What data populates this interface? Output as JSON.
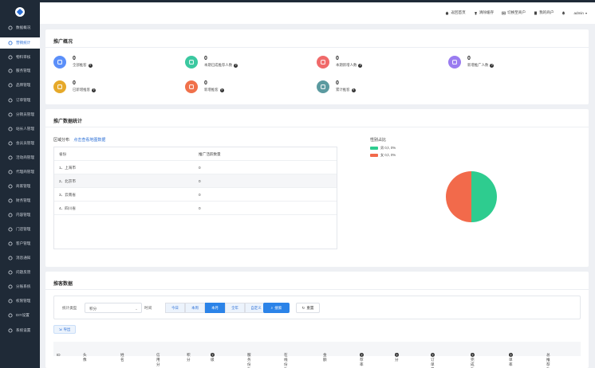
{
  "sidebar": {
    "items": [
      {
        "label": "数据概况",
        "icon": "monitor-icon"
      },
      {
        "label": "营销统计",
        "icon": "chart-icon"
      },
      {
        "label": "物料审核",
        "icon": "box-icon"
      },
      {
        "label": "服务管理",
        "icon": "service-icon"
      },
      {
        "label": "品牌管理",
        "icon": "tag-icon"
      },
      {
        "label": "订单管理",
        "icon": "order-icon"
      },
      {
        "label": "分销员管理",
        "icon": "share-icon"
      },
      {
        "label": "站长人管理",
        "icon": "user-icon"
      },
      {
        "label": "会员员管理",
        "icon": "users-icon"
      },
      {
        "label": "活动商管理",
        "icon": "flag-icon"
      },
      {
        "label": "代理商管理",
        "icon": "agent-icon"
      },
      {
        "label": "商家管理",
        "icon": "shop-icon"
      },
      {
        "label": "财务管理",
        "icon": "wallet-icon"
      },
      {
        "label": "内容管理",
        "icon": "content-icon"
      },
      {
        "label": "门店管理",
        "icon": "store-icon"
      },
      {
        "label": "客户管理",
        "icon": "customer-icon"
      },
      {
        "label": "消息通知",
        "icon": "bell-icon"
      },
      {
        "label": "问题反馈",
        "icon": "feedback-icon"
      },
      {
        "label": "分账系统",
        "icon": "split-icon"
      },
      {
        "label": "权限管理",
        "icon": "lock-icon"
      },
      {
        "label": "DIY设置",
        "icon": "diy-icon"
      },
      {
        "label": "系统设置",
        "icon": "gear-icon"
      }
    ]
  },
  "topbar": {
    "links": [
      {
        "label": "返回首页",
        "icon": "home-icon"
      },
      {
        "label": "清除缓存",
        "icon": "trash-icon"
      },
      {
        "label": "切换至商户",
        "icon": "switch-icon"
      },
      {
        "label": "我的商户",
        "icon": "building-icon"
      }
    ],
    "user": "admin"
  },
  "overview": {
    "title": "推广概况",
    "stats": [
      {
        "value": "0",
        "label": "全部推客",
        "color": "#5b8ff9"
      },
      {
        "value": "0",
        "label": "本期已成推荐人数",
        "color": "#3bc8a0"
      },
      {
        "value": "0",
        "label": "本期新增人数",
        "color": "#f06a6a"
      },
      {
        "value": "0",
        "label": "新增推广人数",
        "color": "#9a7cf0"
      },
      {
        "value": "0",
        "label": "已新增推客",
        "color": "#e6a92a"
      },
      {
        "value": "0",
        "label": "新增推客",
        "color": "#f0714b"
      },
      {
        "value": "0",
        "label": "累计推客",
        "color": "#5b9aa0"
      }
    ]
  },
  "promo_stats": {
    "title": "推广数据统计",
    "region_title": "区域分布",
    "region_link": "点击查看地图数据",
    "table_headers": [
      "省份",
      "推广活跃数量"
    ],
    "rows": [
      {
        "rank": "1、上海市",
        "value": "0"
      },
      {
        "rank": "2、北京市",
        "value": "0"
      },
      {
        "rank": "3、云南省",
        "value": "0"
      },
      {
        "rank": "4、四川省",
        "value": "0"
      }
    ],
    "sex_title": "性别占比",
    "legend": [
      {
        "label": "男 0人 0%",
        "color": "#2ecc8f"
      },
      {
        "label": "女 0人 0%",
        "color": "#f26a4b"
      }
    ],
    "pie": [
      {
        "name": "男",
        "value": 50,
        "color": "#2ecc8f"
      },
      {
        "name": "女",
        "value": 50,
        "color": "#f26a4b"
      }
    ]
  },
  "promo_data": {
    "title": "推客数据",
    "filter_label": "统计类型",
    "select_value": "积分",
    "time_label": "时间",
    "segments": [
      {
        "label": "今日",
        "active": false
      },
      {
        "label": "本周",
        "active": false
      },
      {
        "label": "本月",
        "active": true
      },
      {
        "label": "全年",
        "active": false
      },
      {
        "label": "自定义",
        "active": false
      }
    ],
    "search_label": "搜索",
    "reset_label": "重置",
    "export_label": "导出",
    "columns": [
      "ID",
      "头像",
      "姓名",
      "信用分",
      "积分",
      "等级",
      "服务份数",
      "在线份数",
      "金额",
      "推荐率",
      "积分",
      "总订单量",
      "已完成数量",
      "退单率",
      "总推荐数"
    ]
  }
}
